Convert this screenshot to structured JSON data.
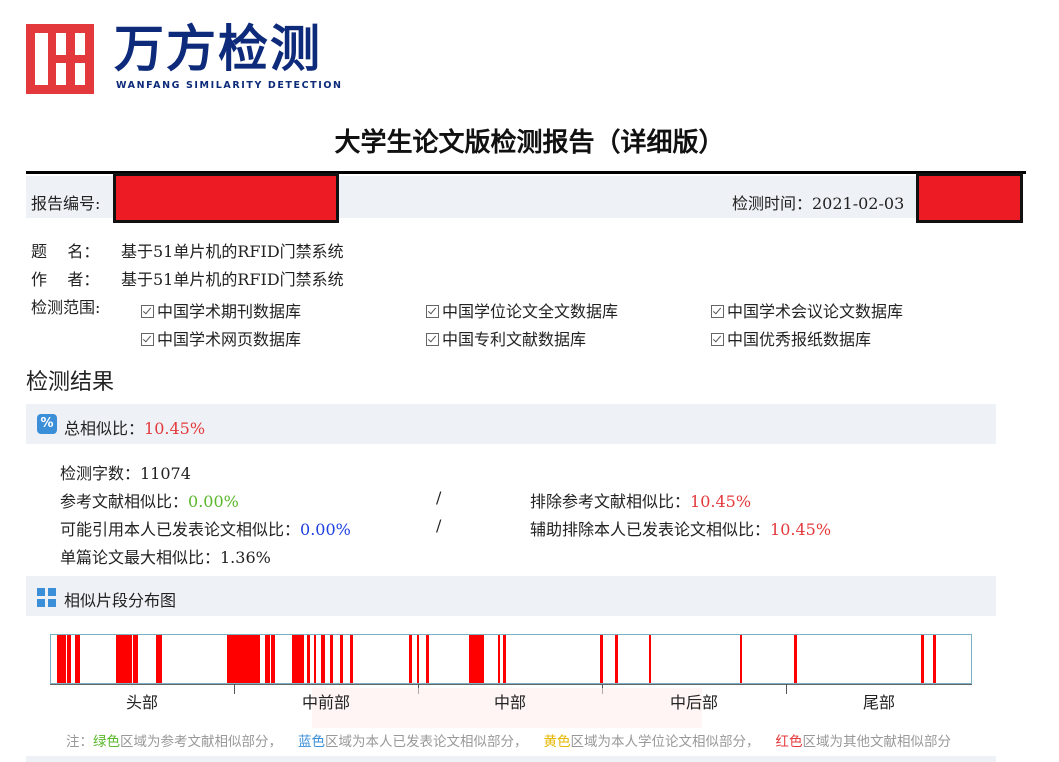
{
  "logo": {
    "cn": "万方检测",
    "en": "WANFANG SIMILARITY DETECTION",
    "brand_color": "#0d2b7a",
    "mark_color": "#e4393c"
  },
  "title": "大学生论文版检测报告（详细版）",
  "report": {
    "number_label": "报告编号:",
    "time_label": "检测时间：2021-02-03"
  },
  "info": {
    "title_label": "题    名：",
    "title_value": "基于51单片机的RFID门禁系统",
    "author_label": "作    者：",
    "author_value": "基于51单片机的RFID门禁系统",
    "scope_label": "检测范围:",
    "databases": [
      "中国学术期刊数据库",
      "中国学位论文全文数据库",
      "中国学术会议论文数据库",
      "中国学术网页数据库",
      "中国专利文献数据库",
      "中国优秀报纸数据库"
    ]
  },
  "results": {
    "heading": "检测结果",
    "total_label": "总相似比：",
    "total_value": "10.45%",
    "word_count_label": "检测字数：11074",
    "ref_label": "参考文献相似比：",
    "ref_value": "0.00%",
    "exclude_ref_label": "排除参考文献相似比：",
    "exclude_ref_value": "10.45%",
    "self_label": "可能引用本人已发表论文相似比：",
    "self_value": "0.00%",
    "aux_label": "辅助排除本人已发表论文相似比：",
    "aux_value": "10.45%",
    "max_label": "单篇论文最大相似比：1.36%",
    "slash": "/"
  },
  "distribution": {
    "heading": "相似片段分布图",
    "segments": [
      "头部",
      "中前部",
      "中部",
      "中后部",
      "尾部"
    ],
    "fragments": [
      [
        0.6,
        0.65
      ],
      [
        1.2,
        0.4
      ],
      [
        1.75,
        0.4
      ],
      [
        2.6,
        0.6
      ],
      [
        7.1,
        1.7
      ],
      [
        8.95,
        0.5
      ],
      [
        11.45,
        0.6
      ],
      [
        19.15,
        3.55
      ],
      [
        23.3,
        0.5
      ],
      [
        23.95,
        0.4
      ],
      [
        26.2,
        1.25
      ],
      [
        27.8,
        0.35
      ],
      [
        28.55,
        0.3
      ],
      [
        29.35,
        0.45
      ],
      [
        30.3,
        0.35
      ],
      [
        31.4,
        0.35
      ],
      [
        32.5,
        0.3
      ],
      [
        38.95,
        0.3
      ],
      [
        39.75,
        0.3
      ],
      [
        40.75,
        0.3
      ],
      [
        45.45,
        1.6
      ],
      [
        48.55,
        0.3
      ],
      [
        49.15,
        0.3
      ],
      [
        59.7,
        0.25
      ],
      [
        61.35,
        0.25
      ],
      [
        64.95,
        0.3
      ],
      [
        74.85,
        0.3
      ],
      [
        80.75,
        0.3
      ],
      [
        94.55,
        0.3
      ],
      [
        95.9,
        0.3
      ]
    ],
    "fragment_color": "#ff0000"
  },
  "note": {
    "prefix": "注：",
    "green": "绿色",
    "green_text": "区域为参考文献相似部分，",
    "blue": "蓝色",
    "blue_text": "区域为本人已发表论文相似部分，",
    "yellow": "黄色",
    "yellow_text": "区域为本人学位论文相似部分，",
    "red": "红色",
    "red_text": "区域为其他文献相似部分"
  }
}
